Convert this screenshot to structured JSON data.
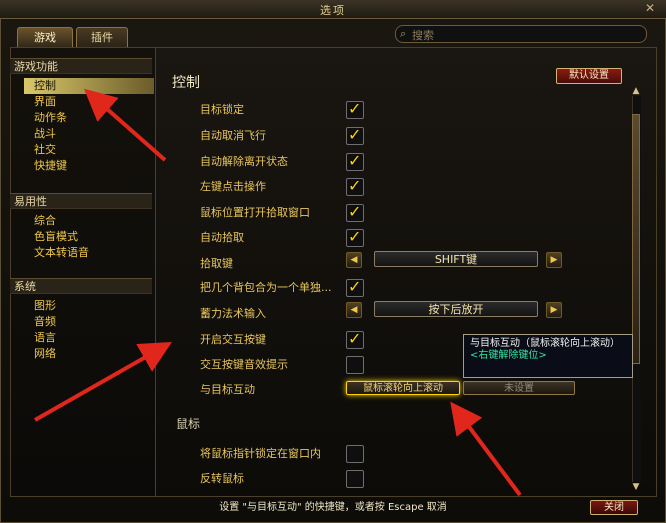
{
  "window": {
    "title": "选项"
  },
  "tabs": [
    {
      "label": "游戏"
    },
    {
      "label": "插件"
    }
  ],
  "search": {
    "placeholder": "搜索"
  },
  "sidebar": {
    "groups": [
      {
        "title": "游戏功能",
        "items": [
          "控制",
          "界面",
          "动作条",
          "战斗",
          "社交",
          "快捷键"
        ]
      },
      {
        "title": "易用性",
        "items": [
          "综合",
          "色盲模式",
          "文本转语音"
        ]
      },
      {
        "title": "系统",
        "items": [
          "图形",
          "音频",
          "语言",
          "网络"
        ]
      }
    ],
    "selected": "控制"
  },
  "main": {
    "title": "控制",
    "reset_label": "默认设置",
    "rows": [
      {
        "label": "目标锁定",
        "checked": true
      },
      {
        "label": "自动取消飞行",
        "checked": true
      },
      {
        "label": "自动解除离开状态",
        "checked": true
      },
      {
        "label": "左键点击操作",
        "checked": true
      },
      {
        "label": "鼠标位置打开拾取窗口",
        "checked": true
      },
      {
        "label": "自动拾取",
        "checked": true
      }
    ],
    "loot_key": {
      "label": "拾取键",
      "value": "SHIFT键"
    },
    "group_bags": {
      "label": "把几个背包合为一个单独...",
      "checked": true
    },
    "cast_input": {
      "label": "蓄力法术输入",
      "value": "按下后放开"
    },
    "interact_key": {
      "label": "开启交互按键",
      "checked": true
    },
    "interact_sound": {
      "label": "交互按键音效提示",
      "checked": false
    },
    "interact_target": {
      "label": "与目标互动",
      "binding_1": "鼠标滚轮向上滚动",
      "binding_2": "未设置"
    },
    "mouse_section": {
      "title": "鼠标"
    },
    "mouse_rows": [
      {
        "label": "将鼠标指针锁定在窗口内",
        "checked": false
      },
      {
        "label": "反转鼠标",
        "checked": false
      }
    ]
  },
  "tooltip": {
    "title": "与目标互动（鼠标滚轮向上滚动）",
    "subtitle": "<右键解除键位>"
  },
  "status": {
    "text": "设置 \"与目标互动\" 的快捷键，或者按 Escape 取消"
  },
  "footer": {
    "close_label": "关闭"
  },
  "colors": {
    "accent": "#ffd400",
    "panel": "#1a1611",
    "label": "#e9c65c",
    "reset": "#8a1a12"
  }
}
